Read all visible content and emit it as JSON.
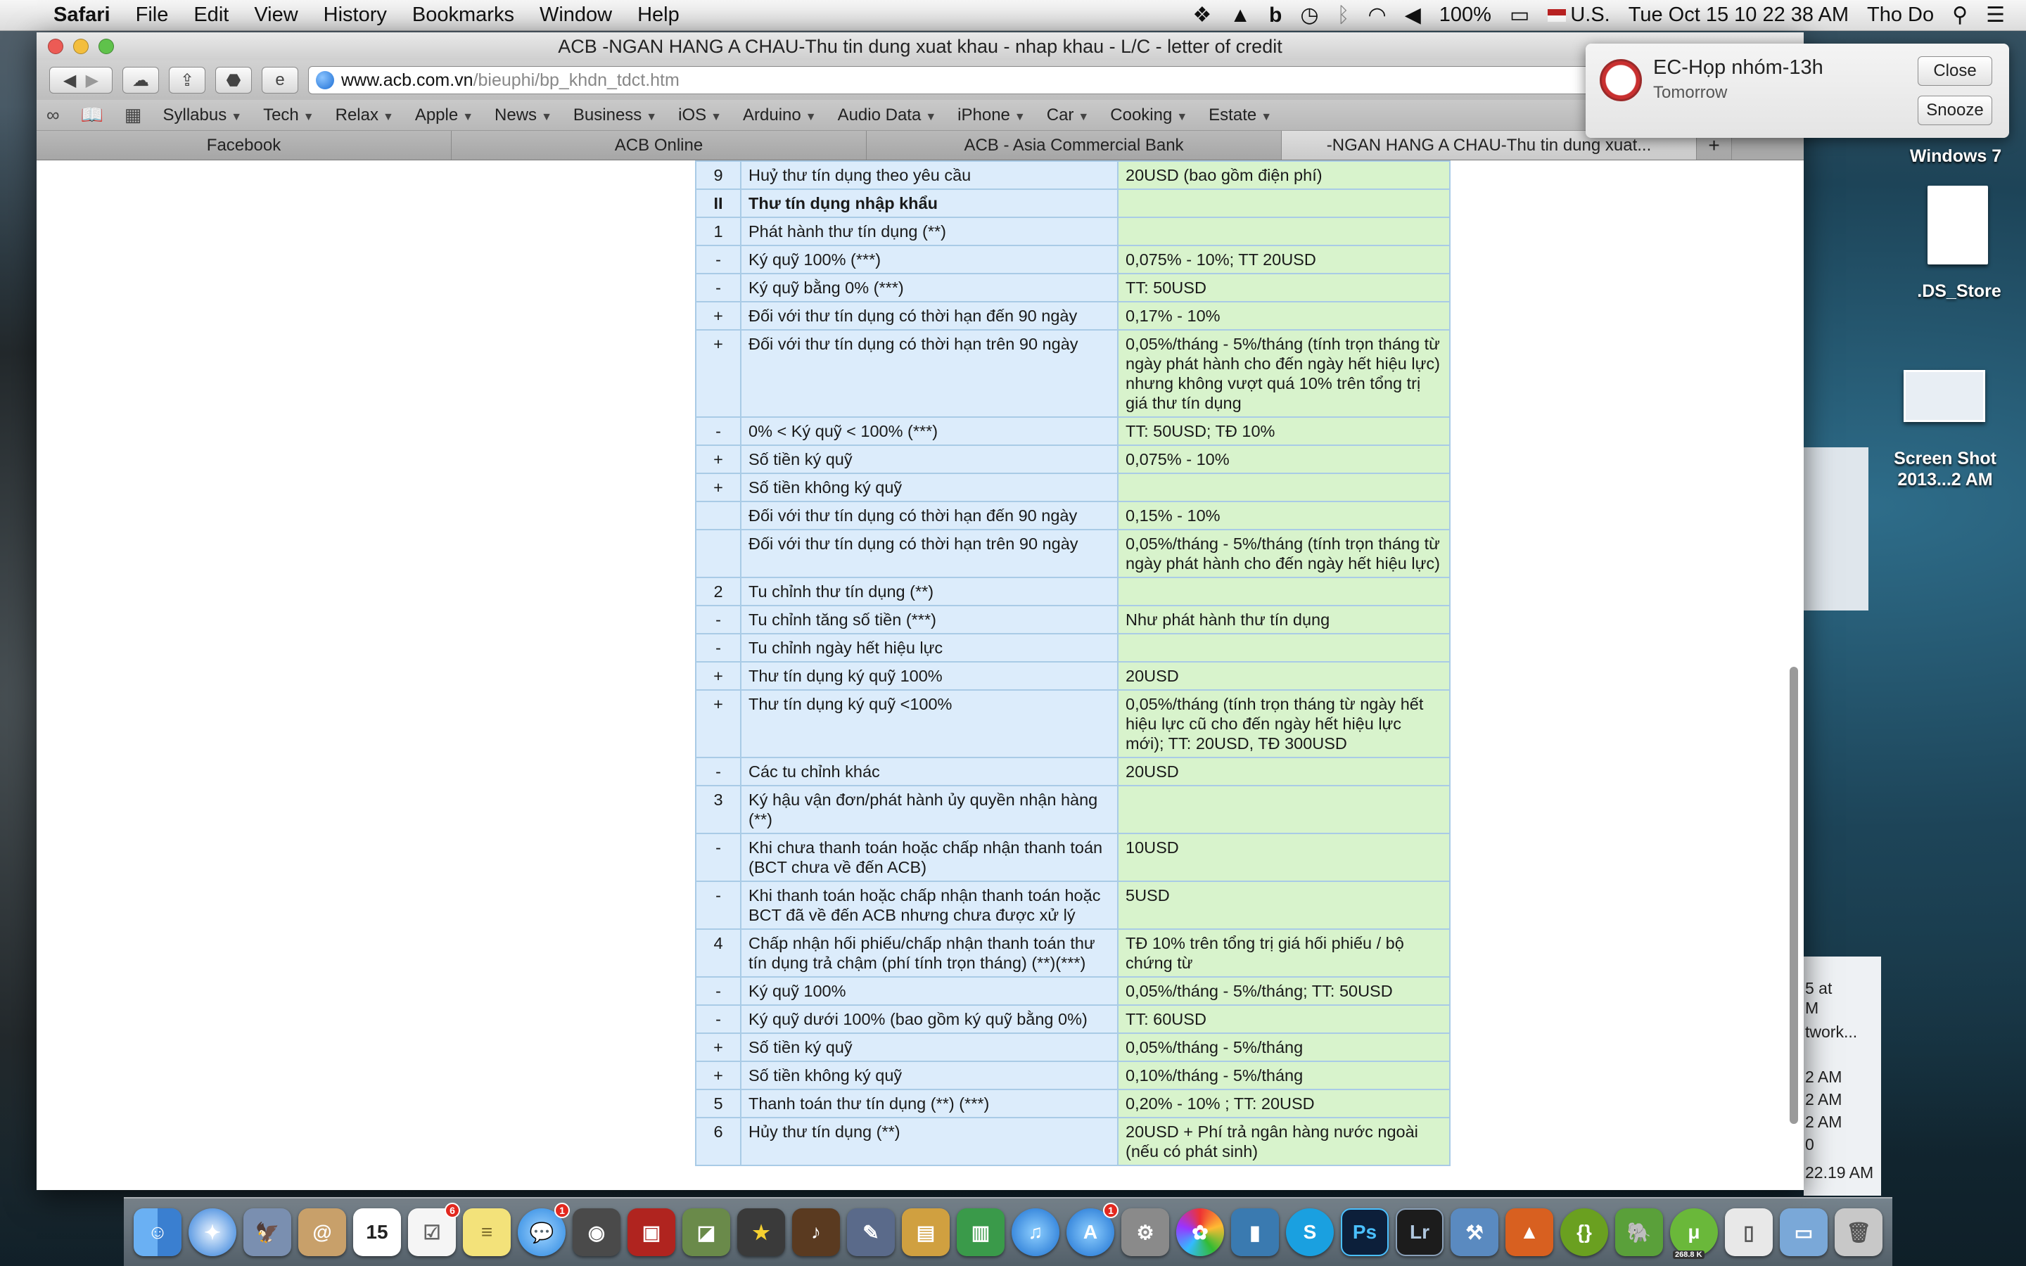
{
  "menubar": {
    "app": "Safari",
    "items": [
      "File",
      "Edit",
      "View",
      "History",
      "Bookmarks",
      "Window",
      "Help"
    ],
    "battery": "100%",
    "input_source": "U.S.",
    "datetime": "Tue Oct 15  10 22 38 AM",
    "user": "Tho Do"
  },
  "window": {
    "title": "ACB -NGAN HANG A CHAU-Thu tin dung xuat khau - nhap khau - L/C - letter of credit",
    "url_domain": "www.acb.com.vn",
    "url_path": "/bieuphi/bp_khdn_tdct.htm"
  },
  "bookmarks": [
    "Syllabus",
    "Tech",
    "Relax",
    "Apple",
    "News",
    "Business",
    "iOS",
    "Arduino",
    "Audio Data",
    "iPhone",
    "Car",
    "Cooking",
    "Estate"
  ],
  "tabs": [
    {
      "label": "Facebook",
      "active": false
    },
    {
      "label": "ACB Online",
      "active": false
    },
    {
      "label": "ACB - Asia Commercial Bank",
      "active": false
    },
    {
      "label": "-NGAN HANG A CHAU-Thu tin dung xuat...",
      "active": true
    }
  ],
  "tab_plus": "+",
  "table": [
    {
      "num": "9",
      "desc": "Huỷ thư tín dụng theo yêu cầu",
      "fee": "20USD (bao gồm điện phí)"
    },
    {
      "num": "II",
      "desc": "Thư tín dụng nhập khẩu",
      "fee": "",
      "header": true
    },
    {
      "num": "1",
      "desc": "Phát hành thư tín dụng (**)",
      "fee": ""
    },
    {
      "num": "-",
      "desc": "Ký quỹ 100% (***)",
      "fee": "0,075% - 10%; TT 20USD"
    },
    {
      "num": "-",
      "desc": "Ký quỹ bằng 0% (***)",
      "fee": "TT: 50USD"
    },
    {
      "num": "+",
      "desc": "Đối với thư tín dụng có thời hạn đến 90 ngày",
      "fee": "0,17% - 10%"
    },
    {
      "num": "+",
      "desc": "Đối với thư tín dụng có thời hạn trên 90 ngày",
      "fee": "0,05%/tháng - 5%/tháng (tính trọn tháng từ ngày phát hành cho đến ngày hết hiệu lực) nhưng không vượt quá 10% trên tổng trị giá thư tín dụng"
    },
    {
      "num": "-",
      "desc": "0% < Ký quỹ < 100% (***)",
      "fee": "TT: 50USD; TĐ 10%"
    },
    {
      "num": "+",
      "desc": "Số tiền ký quỹ",
      "fee": "0,075% - 10%"
    },
    {
      "num": "+",
      "desc": "Số tiền không ký quỹ",
      "fee": ""
    },
    {
      "num": "",
      "desc": "Đối với thư tín dụng có thời hạn đến 90 ngày",
      "fee": "0,15% - 10%"
    },
    {
      "num": "",
      "desc": "Đối với thư tín dụng có thời hạn trên 90 ngày",
      "fee": "0,05%/tháng - 5%/tháng (tính trọn tháng từ ngày phát hành cho đến ngày hết hiệu lực)"
    },
    {
      "num": "2",
      "desc": "Tu chỉnh thư tín dụng (**)",
      "fee": ""
    },
    {
      "num": "-",
      "desc": "Tu chỉnh tăng số tiền (***)",
      "fee": "Như phát hành thư tín dụng"
    },
    {
      "num": "-",
      "desc": "Tu chỉnh ngày hết hiệu lực",
      "fee": ""
    },
    {
      "num": "+",
      "desc": "Thư tín dụng ký quỹ 100%",
      "fee": "20USD"
    },
    {
      "num": "+",
      "desc": "Thư tín dụng ký quỹ <100%",
      "fee": "0,05%/tháng (tính trọn tháng từ ngày hết hiệu lực cũ cho đến ngày hết hiệu lực mới); TT: 20USD, TĐ 300USD"
    },
    {
      "num": "-",
      "desc": "Các tu chỉnh khác",
      "fee": "20USD"
    },
    {
      "num": "3",
      "desc": "Ký hậu vận đơn/phát hành ủy quyền nhận hàng (**)",
      "fee": ""
    },
    {
      "num": "-",
      "desc": "Khi chưa thanh toán hoặc chấp nhận thanh toán (BCT chưa về đến ACB)",
      "fee": "10USD"
    },
    {
      "num": "-",
      "desc": "Khi thanh toán hoặc chấp nhận thanh toán hoặc BCT đã về đến ACB nhưng chưa được xử lý",
      "fee": "5USD"
    },
    {
      "num": "4",
      "desc": "Chấp nhận hối phiếu/chấp nhận thanh toán thư tín dụng trả chậm (phí tính trọn tháng) (**)(***)",
      "fee": "TĐ 10% trên tổng trị giá hối phiếu / bộ chứng từ"
    },
    {
      "num": "-",
      "desc": "Ký quỹ 100%",
      "fee": "0,05%/tháng - 5%/tháng; TT: 50USD"
    },
    {
      "num": "-",
      "desc": "Ký quỹ dưới 100% (bao gồm ký quỹ bằng 0%)",
      "fee": "TT: 60USD"
    },
    {
      "num": "+",
      "desc": "Số tiền ký quỹ",
      "fee": "0,05%/tháng - 5%/tháng"
    },
    {
      "num": "+",
      "desc": "Số tiền không ký quỹ",
      "fee": "0,10%/tháng - 5%/tháng"
    },
    {
      "num": "5",
      "desc": "Thanh toán thư tín dụng (**) (***)",
      "fee": "0,20% - 10% ; TT: 20USD"
    },
    {
      "num": "6",
      "desc": "Hủy thư tín dụng (**)",
      "fee": "20USD + Phí trả ngân hàng nước ngoài (nếu có phát sinh)"
    }
  ],
  "notification": {
    "title": "EC-Họp nhóm-13h",
    "subtitle": "Tomorrow",
    "close_label": "Close",
    "snooze_label": "Snooze"
  },
  "desktop": {
    "windows7": "Windows 7",
    "ds_store": ".DS_Store",
    "screenshot_line1": "Screen Shot",
    "screenshot_line2": "2013...2 AM",
    "side_lines": [
      "5 at",
      "M",
      "twork...",
      "2 AM",
      "2 AM",
      "2 AM",
      "0",
      "22.19 AM"
    ]
  },
  "dock": {
    "calendar_day": "15",
    "reminders_badge": "6",
    "messages_badge": "1",
    "appstore_badge": "1",
    "photoshop": "Ps",
    "lightroom": "Lr",
    "utorrent_speed": "268.8 K"
  }
}
